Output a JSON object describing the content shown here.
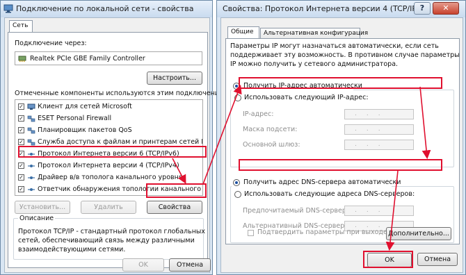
{
  "left_window": {
    "title": "Подключение по локальной сети - свойства",
    "tab": "Сеть",
    "connect_label": "Подключение через:",
    "adapter_name": "Realtek PCIe GBE Family Controller",
    "configure_button": "Настроить...",
    "components_label": "Отмеченные компоненты используются этим подключением:",
    "components": [
      {
        "label": "Клиент для сетей Microsoft",
        "icon": "network-client-icon"
      },
      {
        "label": "ESET Personal Firewall",
        "icon": "network-service-icon"
      },
      {
        "label": "Планировщик пакетов QoS",
        "icon": "network-service-icon"
      },
      {
        "label": "Служба доступа к файлам и принтерам сетей Micro...",
        "icon": "network-service-icon"
      },
      {
        "label": "Протокол Интернета версии 6 (TCP/IPv6)",
        "icon": "protocol-icon"
      },
      {
        "label": "Протокол Интернета версии 4 (TCP/IPv4)",
        "icon": "protocol-icon"
      },
      {
        "label": "Драйвер в/в тополога канального уровня",
        "icon": "protocol-icon"
      },
      {
        "label": "Ответчик обнаружения топологии канального уровня",
        "icon": "protocol-icon"
      }
    ],
    "install_button": "Установить...",
    "remove_button": "Удалить",
    "properties_button": "Свойства",
    "description_title": "Описание",
    "description_text_1": "Протокол TCP/IP - стандартный протокол глобальных",
    "description_text_2": "сетей, обеспечивающий связь между различными",
    "description_text_3": "взаимодействующими сетями.",
    "ok_button": "OK",
    "cancel_button": "Отмена"
  },
  "right_window": {
    "title": "Свойства: Протокол Интернета версии 4 (TCP/IPv4)",
    "help_glyph": "?",
    "close_glyph": "✕",
    "tabs": [
      "Общие",
      "Альтернативная конфигурация"
    ],
    "info_line_1": "Параметры IP могут назначаться автоматически, если сеть",
    "info_line_2": "поддерживает эту возможность. В противном случае параметры",
    "info_line_3": "IP можно получить у сетевого администратора.",
    "radio_ip_auto": "Получить IP-адрес автоматически",
    "radio_ip_manual": "Использовать следующий IP-адрес:",
    "ip_address_label": "IP-адрес:",
    "subnet_mask_label": "Маска подсети:",
    "gateway_label": "Основной шлюз:",
    "radio_dns_auto": "Получить адрес DNS-сервера автоматически",
    "radio_dns_manual": "Использовать следующие адреса DNS-серверов:",
    "preferred_dns_label": "Предпочитаемый DNS-сервер:",
    "alternate_dns_label": "Альтернативный DNS-сервер:",
    "ip_placeholder": "...",
    "validate_checkbox": "Подтвердить параметры при выходе",
    "advanced_button": "Дополнительно...",
    "ok_button": "OK",
    "cancel_button": "Отмена"
  },
  "colors": {
    "highlight": "#e0102f",
    "window_frame": "#d9e6f3"
  }
}
